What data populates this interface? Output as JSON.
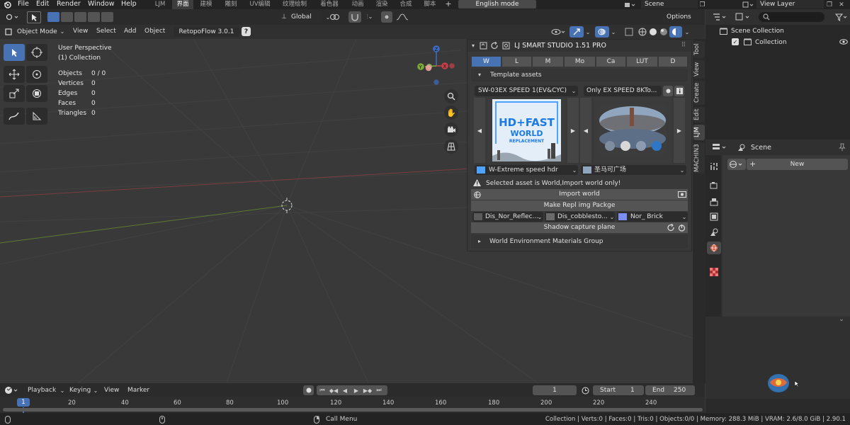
{
  "menu": {
    "file": "File",
    "edit": "Edit",
    "render": "Render",
    "window": "Window",
    "help": "Help"
  },
  "workspaces": [
    "LJM",
    "界面",
    "建模",
    "雕刻",
    "UV编辑",
    "纹理绘制",
    "着色器",
    "动画",
    "渲染",
    "合成",
    "脚本"
  ],
  "english_mode": "English mode",
  "scene_name": "Scene",
  "view_layer": "View Layer",
  "viewport_header": {
    "orientation": "Global",
    "options": "Options"
  },
  "object_mode": "Object Mode",
  "view_menus": [
    "View",
    "Select",
    "Add",
    "Object"
  ],
  "retopoflow": "RetopoFlow 3.0.1",
  "overlay": {
    "perspective": "User Perspective",
    "collection": "(1) Collection"
  },
  "stats": [
    {
      "label": "Objects",
      "value": "0 / 0"
    },
    {
      "label": "Vertices",
      "value": "0"
    },
    {
      "label": "Edges",
      "value": "0"
    },
    {
      "label": "Faces",
      "value": "0"
    },
    {
      "label": "Triangles",
      "value": "0"
    }
  ],
  "gizmo": {
    "x": "X",
    "y": "Y",
    "z": "Z"
  },
  "lj": {
    "title": "LJ SMART STUDIO 1.51 PRO",
    "tabs": [
      "W",
      "L",
      "M",
      "Mo",
      "Ca",
      "LUT",
      "D"
    ],
    "template_assets": "Template assets",
    "preset_left": "SW-03EX SPEED 1(EV&CYC)",
    "preset_right": "Only EX SPEED 8KTo...",
    "thumb_title": "HD+FAST",
    "thumb_sub": "WORLD",
    "thumb_small": "REPLACEMENT",
    "asset_left": "W-Extreme speed hdr",
    "asset_right": "圣马可广场",
    "warning": "Selected asset is World,Import world only!",
    "import_world": "Import world",
    "make_repl": "Make Repl img Packge",
    "map1": "Dis_Nor_Reflec...",
    "map2": "Dis_cobblesto...",
    "map3": "Nor_ Brick",
    "shadow": "Shadow capture plane",
    "world_group": "World Environment Materials Group"
  },
  "side_tabs": [
    "Tool",
    "View",
    "Create",
    "Edit",
    "LJM",
    "MACHIN3"
  ],
  "outliner": {
    "scene_collection": "Scene Collection",
    "collection": "Collection"
  },
  "properties": {
    "scene": "Scene",
    "new": "New"
  },
  "timeline": {
    "playback": "Playback",
    "keying": "Keying",
    "view": "View",
    "marker": "Marker",
    "current_frame": "1",
    "start_label": "Start",
    "start": "1",
    "end_label": "End",
    "end": "250",
    "ticks": [
      "1",
      "20",
      "40",
      "60",
      "80",
      "100",
      "120",
      "140",
      "160",
      "180",
      "200",
      "220",
      "240"
    ]
  },
  "statusbar": {
    "call_menu": "Call Menu",
    "info": "Collection | Verts:0 | Faces:0 | Tris:0 | Objects:0/0 | Memory: 288.3 MiB | VRAM: 2.6/8.0 GiB | 2.90.1"
  }
}
